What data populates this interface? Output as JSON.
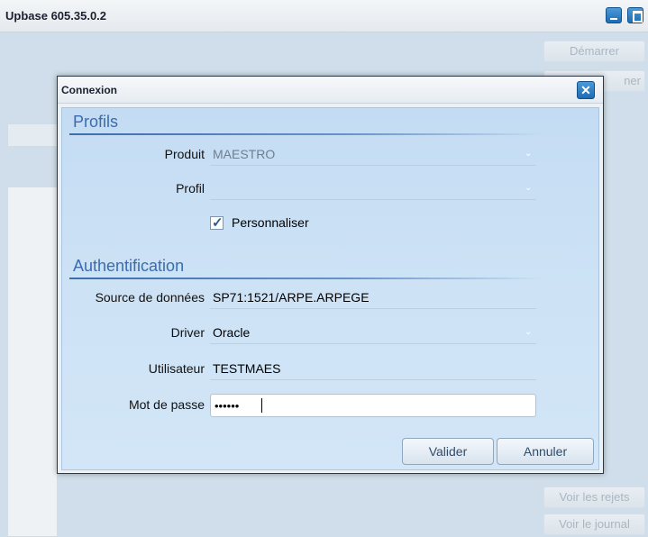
{
  "app": {
    "title": "Upbase 605.35.0.2"
  },
  "background": {
    "start_label": "Démarrer",
    "stop_label_fragment": "ner",
    "rejects_label": "Voir les rejets",
    "journal_label": "Voir le journal"
  },
  "dialog": {
    "title": "Connexion",
    "sections": {
      "profils": "Profils",
      "auth": "Authentification"
    },
    "fields": {
      "produit": {
        "label": "Produit",
        "value": "MAESTRO"
      },
      "profil": {
        "label": "Profil",
        "value": ""
      },
      "personnaliser": {
        "label": "Personnaliser",
        "checked": true
      },
      "source": {
        "label": "Source de données",
        "value": "SP71:1521/ARPE.ARPEGE"
      },
      "driver": {
        "label": "Driver",
        "value": "Oracle"
      },
      "user": {
        "label": "Utilisateur",
        "value": "TESTMAES"
      },
      "password": {
        "label": "Mot de passe",
        "value": "••••••"
      }
    },
    "buttons": {
      "ok": "Valider",
      "cancel": "Annuler"
    }
  },
  "colors": {
    "accent": "#3b6cae",
    "window_button": "#1e6cb2"
  }
}
